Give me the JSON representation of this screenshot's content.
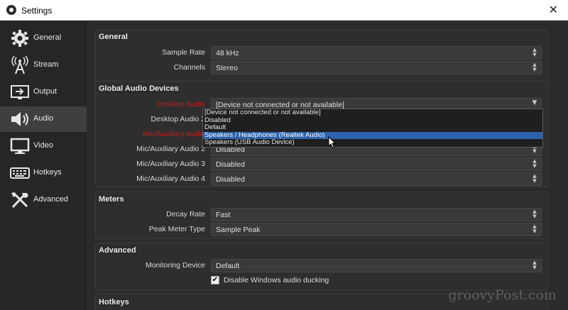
{
  "window": {
    "title": "Settings",
    "close_glyph": "✕"
  },
  "sidebar": {
    "items": [
      {
        "label": "General",
        "icon": "gear-icon"
      },
      {
        "label": "Stream",
        "icon": "broadcast-tower-icon"
      },
      {
        "label": "Output",
        "icon": "output-monitor-icon"
      },
      {
        "label": "Audio",
        "icon": "speaker-icon"
      },
      {
        "label": "Video",
        "icon": "monitor-icon"
      },
      {
        "label": "Hotkeys",
        "icon": "keyboard-icon"
      },
      {
        "label": "Advanced",
        "icon": "tools-icon"
      }
    ],
    "active_index": 3
  },
  "general": {
    "title": "General",
    "sample_rate_label": "Sample Rate",
    "sample_rate_value": "48 kHz",
    "channels_label": "Channels",
    "channels_value": "Stereo"
  },
  "global_audio": {
    "title": "Global Audio Devices",
    "desktop_audio_label": "Desktop Audio",
    "desktop_audio_value": "[Device not connected or not available]",
    "desktop_audio_2_label": "Desktop Audio 2",
    "mic_aux_label": "Mic/Auxiliary Audio",
    "mic_aux_2_label": "Mic/Auxiliary Audio 2",
    "mic_aux_2_value": "Disabled",
    "mic_aux_3_label": "Mic/Auxiliary Audio 3",
    "mic_aux_3_value": "Disabled",
    "mic_aux_4_label": "Mic/Auxiliary Audio 4",
    "mic_aux_4_value": "Disabled"
  },
  "dropdown": {
    "options": [
      "[Device not connected or not available]",
      "Disabled",
      "Default",
      "Speakers / Headphones (Realtek Audio)",
      "Speakers (USB Audio Device)"
    ],
    "highlighted_index": 3
  },
  "meters": {
    "title": "Meters",
    "decay_rate_label": "Decay Rate",
    "decay_rate_value": "Fast",
    "peak_meter_type_label": "Peak Meter Type",
    "peak_meter_type_value": "Sample Peak"
  },
  "advanced": {
    "title": "Advanced",
    "monitoring_device_label": "Monitoring Device",
    "monitoring_device_value": "Default",
    "ducking_label": "Disable Windows audio ducking",
    "ducking_checked": true,
    "check_glyph": "✔"
  },
  "hotkeys": {
    "title": "Hotkeys"
  },
  "combo_arrow_glyph": "▲\n▼",
  "watermark": "groovyPost.com",
  "colors": {
    "panel_bg": "#2b2b2b",
    "sidebar_bg": "#262626",
    "active_item_bg": "#3f3f3f",
    "label_red": "#d11a1a",
    "selection_blue": "#2c63ad"
  }
}
